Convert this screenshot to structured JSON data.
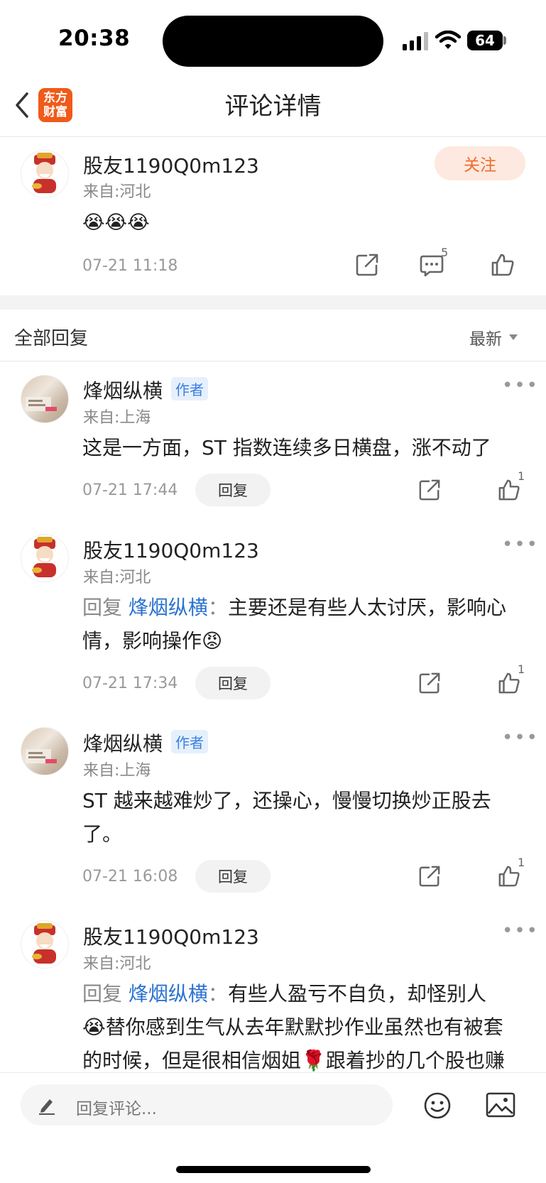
{
  "status_bar": {
    "time": "20:38",
    "battery": "64"
  },
  "nav": {
    "title": "评论详情",
    "logo_line1": "东方",
    "logo_line2": "财富"
  },
  "main_comment": {
    "username": "股友1190Q0m123",
    "location": "来自:河北",
    "emoji": "😭😭😭",
    "timestamp": "07-21 11:18",
    "reply_count": "5",
    "follow_label": "关注"
  },
  "replies_header": {
    "title": "全部回复",
    "sort_label": "最新"
  },
  "replies": [
    {
      "username": "烽烟纵横",
      "author_tag": "作者",
      "location": "来自:上海",
      "text": "这是一方面，ST 指数连续多日横盘，涨不动了",
      "timestamp": "07-21 17:44",
      "reply_label": "回复",
      "likes": "1"
    },
    {
      "username": "股友1190Q0m123",
      "location": "来自:河北",
      "reply_prefix": "回复 ",
      "mention": "烽烟纵横",
      "mention_sep": "：",
      "text_line1": "主要还是有些人太讨厌，影响心",
      "text_line2": "情，影响操作",
      "emoji": "😡",
      "timestamp": "07-21 17:34",
      "reply_label": "回复",
      "likes": "1"
    },
    {
      "username": "烽烟纵横",
      "author_tag": "作者",
      "location": "来自:上海",
      "text_line1": "ST 越来越难炒了，还操心，慢慢切换炒正股去",
      "text_line2": "了。",
      "timestamp": "07-21 16:08",
      "reply_label": "回复",
      "likes": "1"
    },
    {
      "username": "股友1190Q0m123",
      "location": "来自:河北",
      "reply_prefix": "回复 ",
      "mention": "烽烟纵横",
      "mention_sep": "：",
      "text_line1": "有些人盈亏不自负，却怪别人",
      "text_line2_emoji": "😭",
      "text_line2": "替你感到生气从去年默默抄作业虽然也有被套",
      "text_line3a": "的时候，但是很相信烟姐",
      "text_line3_emoji": "🌹",
      "text_line3b": "跟着抄的几个股也赚"
    }
  ],
  "bottom_bar": {
    "placeholder": "回复评论..."
  }
}
